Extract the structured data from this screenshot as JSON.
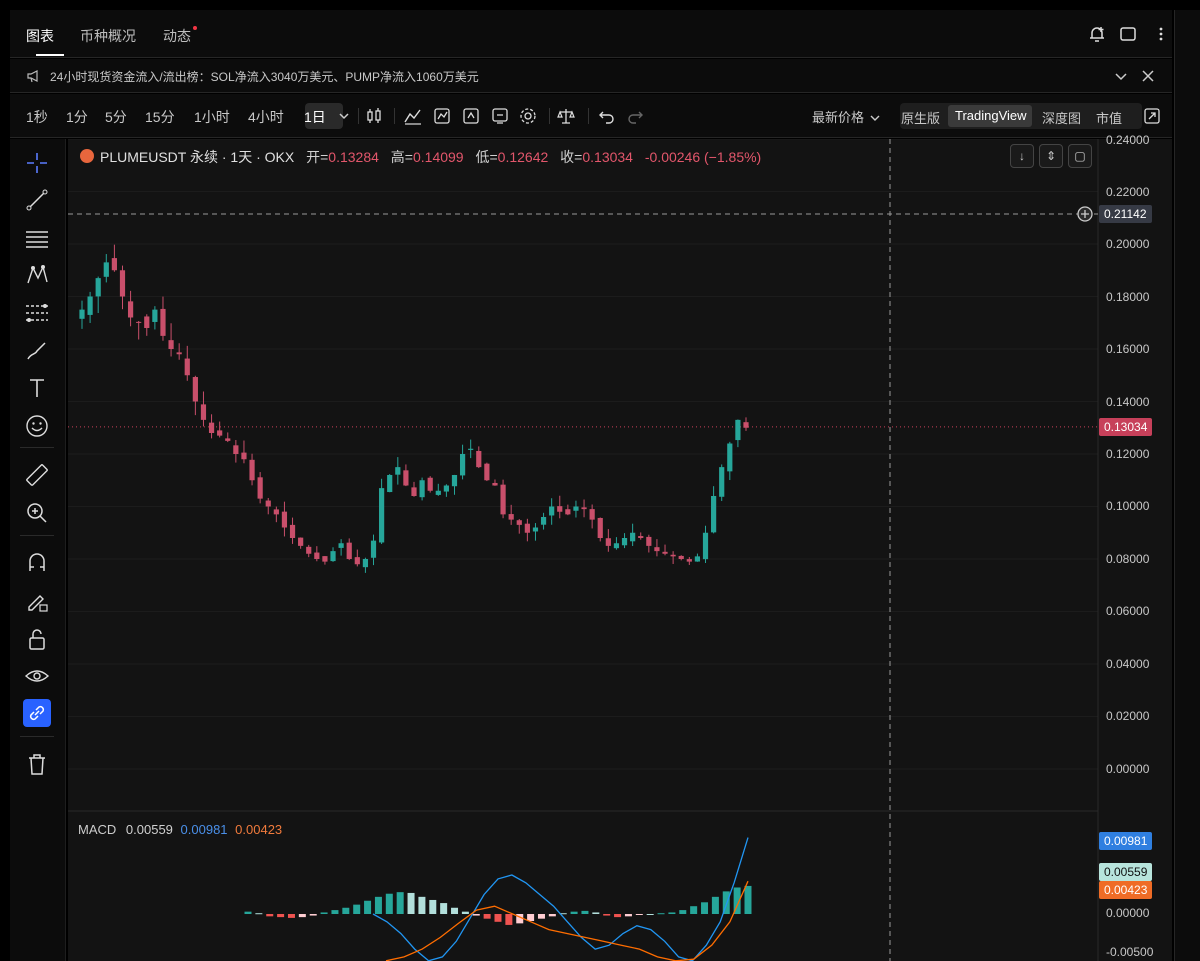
{
  "tabs": [
    {
      "label": "图表",
      "active": true
    },
    {
      "label": "币种概况",
      "active": false
    },
    {
      "label": "动态",
      "active": false,
      "badge": "red-dot"
    }
  ],
  "ticker": {
    "text": "24小时现货资金流入/流出榜：SOL净流入3040万美元、PUMP净流入1060万美元"
  },
  "intervals": [
    "1秒",
    "1分",
    "5分",
    "15分",
    "1小时",
    "4小时",
    "1日"
  ],
  "selected_interval": "1日",
  "price_mode": "最新价格",
  "view_modes": [
    "原生版",
    "TradingView",
    "深度图",
    "市值"
  ],
  "selected_view": "TradingView",
  "legend": {
    "symbol": "PLUMEUSDT 永续 · 1天 · OKX",
    "open_label": "开=",
    "open": "0.13284",
    "high_label": "高=",
    "high": "0.14099",
    "low_label": "低=",
    "low": "0.12642",
    "close_label": "收=",
    "close": "0.13034",
    "change": "-0.00246 (−1.85%)"
  },
  "price_axis": [
    "0.24000",
    "0.22000",
    "0.20000",
    "0.18000",
    "0.16000",
    "0.14000",
    "0.12000",
    "0.10000",
    "0.08000",
    "0.06000",
    "0.04000",
    "0.02000",
    "0.00000"
  ],
  "crosshair_price": "0.21142",
  "last_price": "0.13034",
  "macd": {
    "label": "MACD",
    "hist": "0.00559",
    "macd": "0.00981",
    "signal": "0.00423",
    "axis": [
      "0.00000",
      "-0.00500"
    ]
  },
  "colors": {
    "up": "#26a69a",
    "down": "#ef5350",
    "macd_line": "#2196f3",
    "signal_line": "#ff6d00",
    "accent": "#2962ff"
  },
  "chart_data": {
    "type": "candlestick",
    "series_name": "PLUMEUSDT",
    "ylim": [
      0,
      0.24
    ],
    "close_path": [
      0.175,
      0.18,
      0.187,
      0.193,
      0.19,
      0.18,
      0.172,
      0.17,
      0.168,
      0.175,
      0.165,
      0.16,
      0.158,
      0.15,
      0.14,
      0.133,
      0.128,
      0.127,
      0.125,
      0.12,
      0.118,
      0.11,
      0.103,
      0.1,
      0.097,
      0.092,
      0.088,
      0.085,
      0.082,
      0.08,
      0.079,
      0.083,
      0.086,
      0.08,
      0.078,
      0.08,
      0.087,
      0.107,
      0.112,
      0.115,
      0.108,
      0.104,
      0.11,
      0.106,
      0.106,
      0.108,
      0.112,
      0.12,
      0.122,
      0.115,
      0.11,
      0.108,
      0.097,
      0.095,
      0.093,
      0.09,
      0.092,
      0.096,
      0.1,
      0.098,
      0.097,
      0.1,
      0.099,
      0.095,
      0.088,
      0.085,
      0.086,
      0.088,
      0.09,
      0.088,
      0.085,
      0.083,
      0.082,
      0.081,
      0.08,
      0.079,
      0.081,
      0.09,
      0.104,
      0.115,
      0.124,
      0.133,
      0.13
    ],
    "macd_hist": [
      0.0003,
      0.0001,
      -0.0003,
      -0.0004,
      -0.0005,
      -0.0004,
      -0.0002,
      0.0002,
      0.0005,
      0.0008,
      0.0012,
      0.0017,
      0.0022,
      0.0026,
      0.0028,
      0.0027,
      0.0022,
      0.0018,
      0.0014,
      0.0008,
      0.0003,
      -0.0002,
      -0.0006,
      -0.001,
      -0.0014,
      -0.0012,
      -0.0009,
      -0.0006,
      -0.0003,
      0.0001,
      0.0003,
      0.0004,
      0.0002,
      -0.0002,
      -0.0004,
      -0.0003,
      -0.0001,
      0.0,
      0.0001,
      0.0002,
      0.0005,
      0.001,
      0.0015,
      0.0022,
      0.0029,
      0.0034,
      0.0036
    ],
    "macd_line": [
      0.0,
      -0.001,
      -0.0025,
      -0.0045,
      -0.006,
      -0.0055,
      -0.0035,
      -0.0005,
      0.0025,
      0.0045,
      0.005,
      0.004,
      0.0025,
      0.001,
      -0.001,
      -0.003,
      -0.0045,
      -0.004,
      -0.0025,
      -0.0015,
      -0.002,
      -0.0035,
      -0.0055,
      -0.006,
      -0.004,
      -0.001,
      0.004,
      0.0098
    ],
    "signal_line": [
      -0.006,
      -0.0055,
      -0.0045,
      -0.003,
      -0.0012,
      0.0005,
      0.001,
      0.0,
      -0.001,
      -0.002,
      -0.0025,
      -0.003,
      -0.0035,
      -0.004,
      -0.0045,
      -0.0055,
      -0.006,
      -0.0058,
      -0.004,
      -0.001,
      0.0042
    ]
  }
}
